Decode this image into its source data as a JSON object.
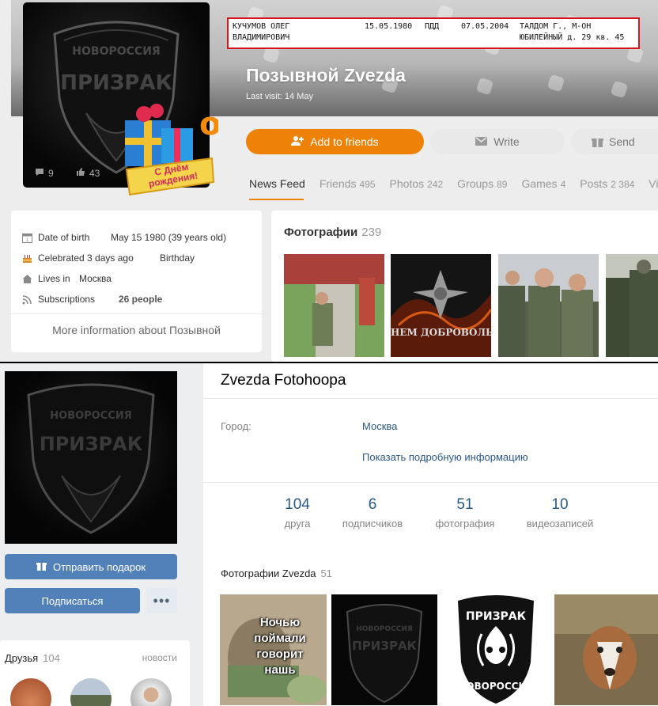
{
  "ok_profile": {
    "record": {
      "surname_name": "КУЧУМОВ ОЛЕГ",
      "patronymic": "ВЛАДИМИРОВИЧ",
      "birth_date": "15.05.1980",
      "code": "ПДД",
      "date2": "07.05.2004",
      "address_line1": "ТАЛДОМ Г., М-ОН",
      "address_line2": "ЮБИЛЕЙНЫЙ д. 29 кв. 45"
    },
    "name": "Позывной Zvezda",
    "last_visit": "Last visit: 14 May",
    "avatar_comments": "9",
    "avatar_likes": "43",
    "avatar_emblem_top": "НОВОРОССИЯ",
    "avatar_emblem_main": "ПРИЗРАК",
    "gift_text_line1": "С Днём",
    "gift_text_line2": "рождения!",
    "buttons": {
      "add_friends": "Add to friends",
      "write": "Write",
      "send": "Send"
    },
    "tabs": [
      {
        "label": "News Feed",
        "count": ""
      },
      {
        "label": "Friends",
        "count": "495"
      },
      {
        "label": "Photos",
        "count": "242"
      },
      {
        "label": "Groups",
        "count": "89"
      },
      {
        "label": "Games",
        "count": "4"
      },
      {
        "label": "Posts",
        "count": "2 384"
      },
      {
        "label": "Vide",
        "count": ""
      }
    ],
    "about": {
      "dob_label": "Date of birth",
      "dob_value": "May 15 1980 (39 years old)",
      "celebrated_label": "Celebrated 3 days ago",
      "celebrated_value": "Birthday",
      "lives_label": "Lives in",
      "lives_value": "Москва",
      "subs_label": "Subscriptions",
      "subs_value": "26 people",
      "more": "More information about Позывной"
    },
    "photos": {
      "title": "Фотографии",
      "count": "239",
      "caption2": "НЕМ ДОБРОВОЛЬЦ"
    },
    "colors": {
      "accent": "#ee8208",
      "highlight_box": "#d8141c"
    }
  },
  "vk_profile": {
    "name": "Zvezda Fotohoopa",
    "city_label": "Город:",
    "city_value": "Москва",
    "show_more": "Показать подробную информацию",
    "counters": [
      {
        "value": "104",
        "label": "друга"
      },
      {
        "value": "6",
        "label": "подписчиков"
      },
      {
        "value": "51",
        "label": "фотография"
      },
      {
        "value": "10",
        "label": "видеозаписей"
      }
    ],
    "gift_button": "Отправить подарок",
    "subscribe_button": "Подписаться",
    "more_button": "•••",
    "friends_title": "Друзья",
    "friends_count": "104",
    "friends_news": "новости",
    "photos_title": "Фотографии Zvezda",
    "photos_count": "51",
    "meme_text": "Ночью поймали говорит нашь",
    "logo_top": "ПРИЗРАК",
    "logo_bottom": "НОВОРОССИЯ",
    "colors": {
      "accent": "#5181b8",
      "link": "#2a5885"
    }
  }
}
